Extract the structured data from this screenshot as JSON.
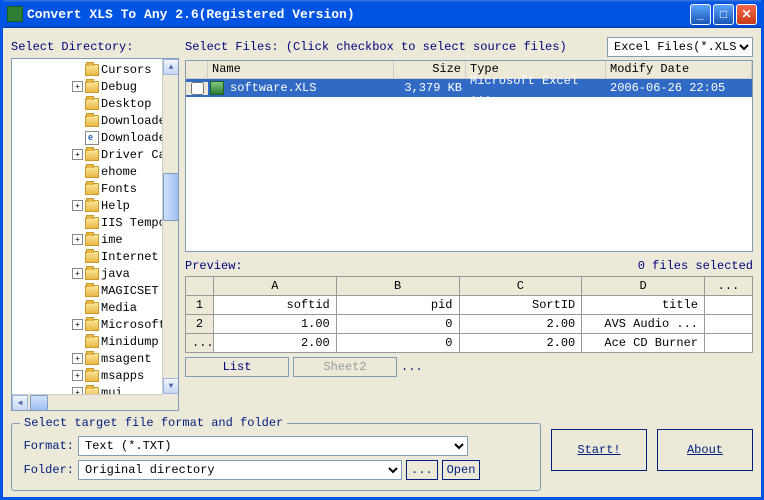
{
  "window": {
    "title": "Convert XLS To Any 2.6(Registered Version)"
  },
  "labels": {
    "select_dir": "Select Directory:",
    "select_files": "Select Files: (Click checkbox to select source files)",
    "preview": "Preview:",
    "files_selected": "0 files selected",
    "format": "Format:",
    "folder": "Folder:",
    "target_legend": "Select target file format and folder"
  },
  "filter": {
    "selected": "Excel Files(*.XLS)"
  },
  "tree": {
    "indent": 60,
    "items": [
      {
        "exp": "",
        "icon": "folder",
        "label": "Cursors"
      },
      {
        "exp": "+",
        "icon": "folder",
        "label": "Debug"
      },
      {
        "exp": "",
        "icon": "folder",
        "label": "Desktop"
      },
      {
        "exp": "",
        "icon": "folder",
        "label": "Downloade"
      },
      {
        "exp": "",
        "icon": "html",
        "label": "Downloade"
      },
      {
        "exp": "+",
        "icon": "folder",
        "label": "Driver Ca"
      },
      {
        "exp": "",
        "icon": "folder",
        "label": "ehome"
      },
      {
        "exp": "",
        "icon": "folder",
        "label": "Fonts"
      },
      {
        "exp": "+",
        "icon": "folder",
        "label": "Help"
      },
      {
        "exp": "",
        "icon": "folder",
        "label": "IIS Tempo"
      },
      {
        "exp": "+",
        "icon": "folder",
        "label": "ime"
      },
      {
        "exp": "",
        "icon": "folder",
        "label": "Internet"
      },
      {
        "exp": "+",
        "icon": "folder",
        "label": "java"
      },
      {
        "exp": "",
        "icon": "folder",
        "label": "MAGICSET"
      },
      {
        "exp": "",
        "icon": "folder",
        "label": "Media"
      },
      {
        "exp": "+",
        "icon": "folder",
        "label": "Microsoft"
      },
      {
        "exp": "",
        "icon": "folder",
        "label": "Minidump"
      },
      {
        "exp": "+",
        "icon": "folder",
        "label": "msagent"
      },
      {
        "exp": "+",
        "icon": "folder",
        "label": "msapps"
      },
      {
        "exp": "+",
        "icon": "folder",
        "label": "mui"
      }
    ]
  },
  "file_list": {
    "headers": {
      "name": "Name",
      "size": "Size",
      "type": "Type",
      "date": "Modify Date"
    },
    "rows": [
      {
        "name": "software.XLS",
        "size": "3,379 KB",
        "type": "Microsoft Excel ...",
        "date": "2006-06-26 22:05"
      }
    ]
  },
  "preview_table": {
    "cols": [
      "A",
      "B",
      "C",
      "D",
      "..."
    ],
    "rows": [
      {
        "head": "1",
        "cells": [
          "softid",
          "pid",
          "SortID",
          "title",
          ""
        ]
      },
      {
        "head": "2",
        "cells": [
          "1.00",
          "0",
          "2.00",
          "AVS Audio ...",
          ""
        ]
      },
      {
        "head": "...",
        "cells": [
          "2.00",
          "0",
          "2.00",
          "Ace CD Burner",
          ""
        ]
      }
    ]
  },
  "sheets": {
    "active": "List",
    "inactive": "Sheet2",
    "more": "..."
  },
  "format": {
    "selected": "Text (*.TXT)"
  },
  "folder": {
    "selected": "Original directory"
  },
  "buttons": {
    "browse": "...",
    "open": "Open",
    "start": "Start!",
    "about": "About"
  }
}
